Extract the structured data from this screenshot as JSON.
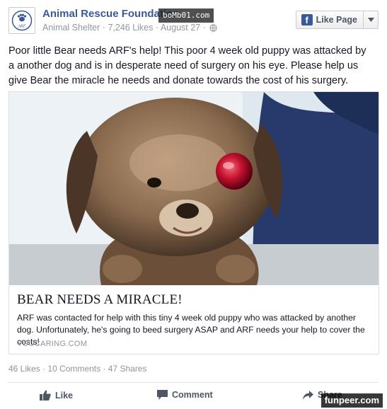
{
  "header": {
    "page_name": "Animal Rescue Foundation",
    "category": "Animal Shelter",
    "likes": "7,246 Likes",
    "date": "August 27",
    "separator": "·",
    "like_page_label": "Like Page",
    "avatar_text": "ARF"
  },
  "watermarks": {
    "top": "boMb01.com",
    "bottom": "funpeer.com"
  },
  "post": {
    "text": "Poor little Bear needs ARF's help! This poor 4 week old puppy was attacked by a another dog and is in desperate need of surgery on his eye. Please help us give Bear the miracle he needs and donate towards the cost of his surgery."
  },
  "link_card": {
    "title": "BEAR NEEDS A MIRACLE!",
    "description": "ARF was contacted for help with this tiny 4 week old puppy who was attacked by another dog. Unfortunately, he's going to beed surgery ASAP and ARF needs your help to cover the costs!",
    "source": "YOUCARING.COM"
  },
  "stats": {
    "likes": "46 Likes",
    "comments": "10 Comments",
    "shares": "47 Shares",
    "separator": "·"
  },
  "actions": {
    "like": "Like",
    "comment": "Comment",
    "share": "Share"
  },
  "colors": {
    "brand": "#3b5998",
    "muted": "#9197a3",
    "text": "#141823",
    "action": "#4e5665"
  },
  "icons": [
    "paw-icon",
    "globe-icon",
    "facebook-icon",
    "chevron-down-icon",
    "thumbs-up-icon",
    "comment-icon",
    "share-icon"
  ]
}
